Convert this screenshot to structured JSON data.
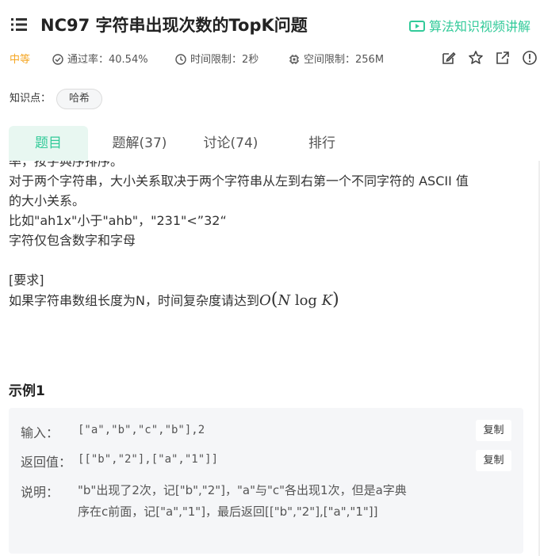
{
  "header": {
    "title": "NC97  字符串出现次数的TopK问题",
    "video_link": "算法知识视频讲解"
  },
  "meta": {
    "difficulty": "中等",
    "pass_rate": "通过率：40.54%",
    "time_limit": "时间限制：2秒",
    "space_limit": "空间限制：256M"
  },
  "knowledge": {
    "label": "知识点：",
    "tags": [
      "哈希"
    ]
  },
  "tabs": [
    {
      "label": "题目",
      "active": true
    },
    {
      "label": "题解(37)"
    },
    {
      "label": "讨论(74)"
    },
    {
      "label": "排行"
    }
  ],
  "description": {
    "cut_line": "率，按字典序排序。",
    "line1": "对于两个字符串，大小关系取决于两个字符串从左到右第一个不同字符的 ASCII 值",
    "line2": "的大小关系。",
    "line3": "比如\"ah1x\"小于\"ahb\"，\"231\"<”32“",
    "line4": "字符仅包含数字和字母",
    "req_title": "[要求]",
    "req_text": "如果字符串数组长度为N，时间复杂度请达到",
    "math": {
      "o": "O",
      "n": "N",
      "log": "log",
      "k": "K"
    }
  },
  "example": {
    "title": "示例1",
    "input_label": "输入：",
    "input_value": "[\"a\",\"b\",\"c\",\"b\"],2",
    "output_label": "返回值：",
    "output_value": "[[\"b\",\"2\"],[\"a\",\"1\"]]",
    "copy_label": "复制",
    "explain_label": "说明：",
    "explain_line1": "\"b\"出现了2次，记[\"b\",\"2\"]，\"a\"与\"c\"各出现1次，但是a字典",
    "explain_line2": "序在c前面，记[\"a\",\"1\"]，最后返回[[\"b\",\"2\"],[\"a\",\"1\"]]"
  },
  "colors": {
    "accent": "#32ca99",
    "difficulty": "#f5a623",
    "tab_active_bg": "#e8f7f1",
    "example_bg": "#f5f6f8"
  },
  "icons": [
    "menu-icon",
    "video-icon",
    "check-circle-icon",
    "clock-icon",
    "chip-icon",
    "edit-icon",
    "star-icon",
    "external-link-icon",
    "info-icon"
  ]
}
